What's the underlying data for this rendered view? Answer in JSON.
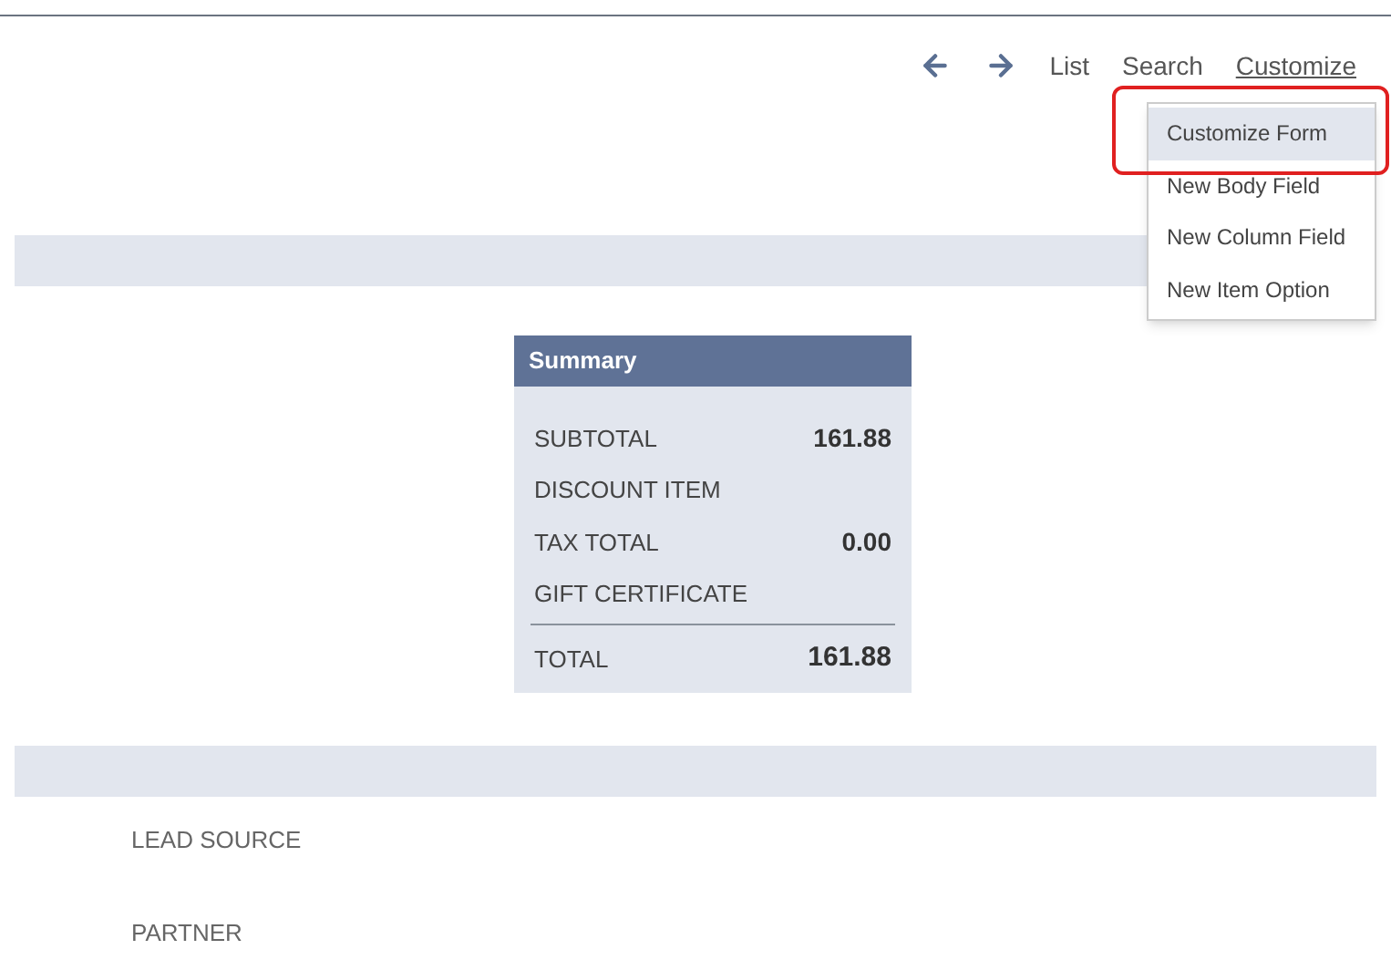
{
  "nav": {
    "links": [
      {
        "label": "List",
        "selected": false
      },
      {
        "label": "Search",
        "selected": false
      },
      {
        "label": "Customize",
        "selected": true
      }
    ]
  },
  "menu": {
    "items": [
      {
        "label": "Customize Form",
        "selected": true
      },
      {
        "label": "New Body Field",
        "selected": false
      },
      {
        "label": "New Column Field",
        "selected": false
      },
      {
        "label": "New Item Option",
        "selected": false
      }
    ]
  },
  "summary": {
    "title": "Summary",
    "rows": [
      {
        "label": "SUBTOTAL",
        "value": "161.88"
      },
      {
        "label": "DISCOUNT ITEM"
      },
      {
        "label": "TAX TOTAL",
        "value": "0.00"
      },
      {
        "label": "GIFT CERTIFICATE"
      }
    ],
    "total": {
      "label": "TOTAL",
      "value": "161.88"
    }
  },
  "fields": [
    "LEAD SOURCE",
    "PARTNER"
  ]
}
